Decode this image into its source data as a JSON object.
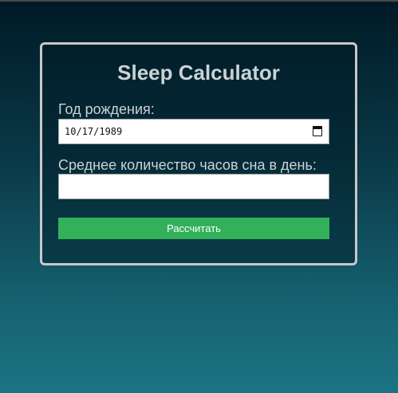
{
  "card": {
    "title": "Sleep Calculator",
    "birth_label": "Год рождения:",
    "birth_value": "10/17/1989",
    "sleep_label": "Среднее количество часов сна в день:",
    "sleep_value": "",
    "button_label": "Рассчитать"
  },
  "colors": {
    "button": "#33b05a",
    "text": "#c9d3d6",
    "card_border": "#c8c8c8",
    "bg_top": "#001a26",
    "bg_bottom": "#1b7482"
  },
  "icons": {
    "date_picker": "calendar-icon"
  }
}
